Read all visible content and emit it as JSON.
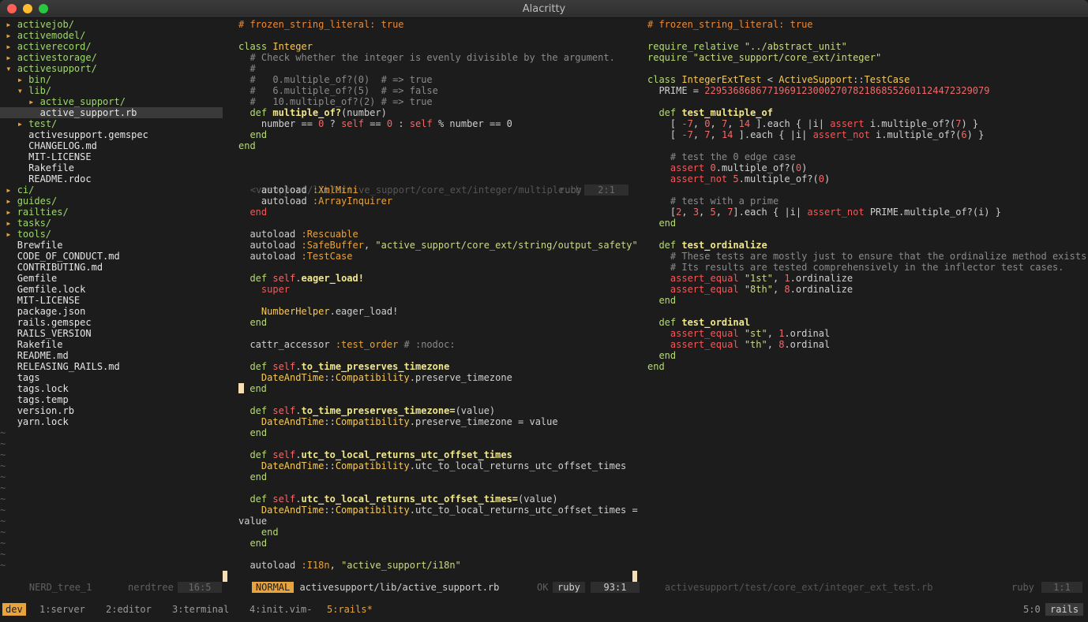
{
  "window": {
    "title": "Alacritty"
  },
  "tree": [
    {
      "icon": "▸ ",
      "name": "activejob/",
      "indent": 1,
      "kind": "dir"
    },
    {
      "icon": "▸ ",
      "name": "activemodel/",
      "indent": 1,
      "kind": "dir"
    },
    {
      "icon": "▸ ",
      "name": "activerecord/",
      "indent": 1,
      "kind": "dir"
    },
    {
      "icon": "▸ ",
      "name": "activestorage/",
      "indent": 1,
      "kind": "dir"
    },
    {
      "icon": "▾ ",
      "name": "activesupport/",
      "indent": 1,
      "kind": "dir"
    },
    {
      "icon": "▸ ",
      "name": "bin/",
      "indent": 3,
      "kind": "dir"
    },
    {
      "icon": "▾ ",
      "name": "lib/",
      "indent": 3,
      "kind": "dir"
    },
    {
      "icon": "▸ ",
      "name": "active_support/",
      "indent": 5,
      "kind": "dir"
    },
    {
      "icon": "",
      "name": "active_support.rb",
      "indent": 7,
      "kind": "file",
      "selected": true
    },
    {
      "icon": "▸ ",
      "name": "test/",
      "indent": 3,
      "kind": "dir"
    },
    {
      "icon": "",
      "name": "activesupport.gemspec",
      "indent": 5,
      "kind": "file"
    },
    {
      "icon": "",
      "name": "CHANGELOG.md",
      "indent": 5,
      "kind": "file"
    },
    {
      "icon": "",
      "name": "MIT-LICENSE",
      "indent": 5,
      "kind": "file"
    },
    {
      "icon": "",
      "name": "Rakefile",
      "indent": 5,
      "kind": "file"
    },
    {
      "icon": "",
      "name": "README.rdoc",
      "indent": 5,
      "kind": "file"
    },
    {
      "icon": "▸ ",
      "name": "ci/",
      "indent": 1,
      "kind": "dir"
    },
    {
      "icon": "▸ ",
      "name": "guides/",
      "indent": 1,
      "kind": "dir"
    },
    {
      "icon": "▸ ",
      "name": "railties/",
      "indent": 1,
      "kind": "dir"
    },
    {
      "icon": "▸ ",
      "name": "tasks/",
      "indent": 1,
      "kind": "dir"
    },
    {
      "icon": "▸ ",
      "name": "tools/",
      "indent": 1,
      "kind": "dir"
    },
    {
      "icon": "",
      "name": "Brewfile",
      "indent": 3,
      "kind": "file"
    },
    {
      "icon": "",
      "name": "CODE_OF_CONDUCT.md",
      "indent": 3,
      "kind": "file"
    },
    {
      "icon": "",
      "name": "CONTRIBUTING.md",
      "indent": 3,
      "kind": "file"
    },
    {
      "icon": "",
      "name": "Gemfile",
      "indent": 3,
      "kind": "file"
    },
    {
      "icon": "",
      "name": "Gemfile.lock",
      "indent": 3,
      "kind": "file"
    },
    {
      "icon": "",
      "name": "MIT-LICENSE",
      "indent": 3,
      "kind": "file"
    },
    {
      "icon": "",
      "name": "package.json",
      "indent": 3,
      "kind": "file"
    },
    {
      "icon": "",
      "name": "rails.gemspec",
      "indent": 3,
      "kind": "file"
    },
    {
      "icon": "",
      "name": "RAILS_VERSION",
      "indent": 3,
      "kind": "file"
    },
    {
      "icon": "",
      "name": "Rakefile",
      "indent": 3,
      "kind": "file"
    },
    {
      "icon": "",
      "name": "README.md",
      "indent": 3,
      "kind": "file"
    },
    {
      "icon": "",
      "name": "RELEASING_RAILS.md",
      "indent": 3,
      "kind": "file"
    },
    {
      "icon": "",
      "name": "tags",
      "indent": 3,
      "kind": "file"
    },
    {
      "icon": "",
      "name": "tags.lock",
      "indent": 3,
      "kind": "file"
    },
    {
      "icon": "",
      "name": "tags.temp",
      "indent": 3,
      "kind": "file"
    },
    {
      "icon": "",
      "name": "version.rb",
      "indent": 3,
      "kind": "file"
    },
    {
      "icon": "",
      "name": "yarn.lock",
      "indent": 3,
      "kind": "file"
    }
  ],
  "tree_tildes": 13,
  "middle_top": [
    [
      [
        "c-cmo",
        "# frozen_string_literal: true"
      ]
    ],
    [],
    [
      [
        "c-kw",
        "class "
      ],
      [
        "c-cls",
        "Integer"
      ]
    ],
    [
      [
        "c-cm",
        "  # Check whether the integer is evenly divisible by the argument."
      ]
    ],
    [
      [
        "c-cm",
        "  #"
      ]
    ],
    [
      [
        "c-cm",
        "  #   0.multiple_of?(0)  # => true"
      ]
    ],
    [
      [
        "c-cm",
        "  #   6.multiple_of?(5)  # => false"
      ]
    ],
    [
      [
        "c-cm",
        "  #   10.multiple_of?(2) # => true"
      ]
    ],
    [
      [
        "c-kw",
        "  def "
      ],
      [
        "c-fn",
        "multiple_of?"
      ],
      [
        "c-op",
        "(number)"
      ]
    ],
    [
      [
        "c-op",
        "    number == "
      ],
      [
        "c-num",
        "0"
      ],
      [
        "c-op",
        " ? "
      ],
      [
        "c-self",
        "self"
      ],
      [
        "c-op",
        " == "
      ],
      [
        "c-num",
        "0"
      ],
      [
        "c-op",
        " : "
      ],
      [
        "c-self",
        "self"
      ],
      [
        "c-op",
        " % number == 0"
      ]
    ],
    [
      [
        "c-kw",
        "  end"
      ]
    ],
    [
      [
        "c-kw",
        "end"
      ]
    ]
  ],
  "middle_top_tildes": 2,
  "middle_inactive_status": {
    "path": "<vesupport/lib/active_support/core_ext/integer/multiple.rb",
    "ft": "ruby",
    "pos": "2:1"
  },
  "middle_bottom": [
    [
      [
        "c-op",
        "    autoload "
      ],
      [
        "c-sym",
        ":XmlMini"
      ]
    ],
    [
      [
        "c-op",
        "    autoload "
      ],
      [
        "c-sym",
        ":ArrayInquirer"
      ]
    ],
    [
      [
        "c-sp",
        "  end"
      ]
    ],
    [],
    [
      [
        "c-op",
        "  autoload "
      ],
      [
        "c-sym",
        ":Rescuable"
      ]
    ],
    [
      [
        "c-op",
        "  autoload "
      ],
      [
        "c-sym",
        ":SafeBuffer"
      ],
      [
        "c-op",
        ", "
      ],
      [
        "c-str",
        "\"active_support/core_ext/string/output_safety\""
      ]
    ],
    [
      [
        "c-op",
        "  autoload "
      ],
      [
        "c-sym",
        ":TestCase"
      ]
    ],
    [],
    [
      [
        "c-kw",
        "  def "
      ],
      [
        "c-self",
        "self"
      ],
      [
        "c-op",
        "."
      ],
      [
        "c-fn",
        "eager_load!"
      ]
    ],
    [
      [
        "c-as",
        "    super"
      ]
    ],
    [],
    [
      [
        "c-cls",
        "    NumberHelper"
      ],
      [
        "c-op",
        ".eager_load!"
      ]
    ],
    [
      [
        "c-kw",
        "  end"
      ]
    ],
    [],
    [
      [
        "c-op",
        "  cattr_accessor "
      ],
      [
        "c-sym",
        ":test_order"
      ],
      [
        "c-cm",
        " # :nodoc:"
      ]
    ],
    [],
    [
      [
        "c-kw",
        "  def "
      ],
      [
        "c-self",
        "self"
      ],
      [
        "c-op",
        "."
      ],
      [
        "c-fn",
        "to_time_preserves_timezone"
      ]
    ],
    [
      [
        "c-cls",
        "    DateAndTime"
      ],
      [
        "c-op",
        "::"
      ],
      [
        "c-cls",
        "Compatibility"
      ],
      [
        "c-op",
        ".preserve_timezone"
      ]
    ],
    [
      [
        "cursor",
        ""
      ],
      [
        "c-kw",
        " end"
      ]
    ],
    [],
    [
      [
        "c-kw",
        "  def "
      ],
      [
        "c-self",
        "self"
      ],
      [
        "c-op",
        "."
      ],
      [
        "c-fn",
        "to_time_preserves_timezone="
      ],
      [
        "c-op",
        "(value)"
      ]
    ],
    [
      [
        "c-cls",
        "    DateAndTime"
      ],
      [
        "c-op",
        "::"
      ],
      [
        "c-cls",
        "Compatibility"
      ],
      [
        "c-op",
        ".preserve_timezone = value"
      ]
    ],
    [
      [
        "c-kw",
        "  end"
      ]
    ],
    [],
    [
      [
        "c-kw",
        "  def "
      ],
      [
        "c-self",
        "self"
      ],
      [
        "c-op",
        "."
      ],
      [
        "c-fn",
        "utc_to_local_returns_utc_offset_times"
      ]
    ],
    [
      [
        "c-cls",
        "    DateAndTime"
      ],
      [
        "c-op",
        "::"
      ],
      [
        "c-cls",
        "Compatibility"
      ],
      [
        "c-op",
        ".utc_to_local_returns_utc_offset_times"
      ]
    ],
    [
      [
        "c-kw",
        "  end"
      ]
    ],
    [],
    [
      [
        "c-kw",
        "  def "
      ],
      [
        "c-self",
        "self"
      ],
      [
        "c-op",
        "."
      ],
      [
        "c-fn",
        "utc_to_local_returns_utc_offset_times="
      ],
      [
        "c-op",
        "(value)"
      ]
    ],
    [
      [
        "c-cls",
        "    DateAndTime"
      ],
      [
        "c-op",
        "::"
      ],
      [
        "c-cls",
        "Compatibility"
      ],
      [
        "c-op",
        ".utc_to_local_returns_utc_offset_times ="
      ]
    ],
    [
      [
        "c-op",
        "value"
      ]
    ],
    [
      [
        "c-kw",
        "    end"
      ]
    ],
    [
      [
        "c-kw",
        "  end"
      ]
    ],
    [],
    [
      [
        "c-op",
        "  autoload "
      ],
      [
        "c-sym",
        ":I18n"
      ],
      [
        "c-op",
        ", "
      ],
      [
        "c-str",
        "\"active_support/i18n\""
      ]
    ]
  ],
  "right_code": [
    [
      [
        "c-cmo",
        "# frozen_string_literal: true"
      ]
    ],
    [],
    [
      [
        "c-kw",
        "require_relative "
      ],
      [
        "c-str",
        "\"../abstract_unit\""
      ]
    ],
    [
      [
        "c-kw",
        "require "
      ],
      [
        "c-str",
        "\"active_support/core_ext/integer\""
      ]
    ],
    [],
    [
      [
        "c-kw",
        "class "
      ],
      [
        "c-cls",
        "IntegerExtTest"
      ],
      [
        "c-op",
        " < "
      ],
      [
        "c-cls",
        "ActiveSupport"
      ],
      [
        "c-op",
        "::"
      ],
      [
        "c-cls",
        "TestCase"
      ]
    ],
    [
      [
        "c-op",
        "  PRIME = "
      ],
      [
        "c-num",
        "22953686867719691230002707821868552601124472329079"
      ]
    ],
    [],
    [
      [
        "c-kw",
        "  def "
      ],
      [
        "c-fn",
        "test_multiple_of"
      ]
    ],
    [
      [
        "c-op",
        "    [ "
      ],
      [
        "c-num",
        "-7"
      ],
      [
        "c-op",
        ", "
      ],
      [
        "c-num",
        "0"
      ],
      [
        "c-op",
        ", "
      ],
      [
        "c-num",
        "7"
      ],
      [
        "c-op",
        ", "
      ],
      [
        "c-num",
        "14"
      ],
      [
        "c-op",
        " ].each { |i| "
      ],
      [
        "c-as",
        "assert"
      ],
      [
        "c-op",
        " i.multiple_of?("
      ],
      [
        "c-num",
        "7"
      ],
      [
        "c-op",
        ") }"
      ]
    ],
    [
      [
        "c-op",
        "    [ "
      ],
      [
        "c-num",
        "-7"
      ],
      [
        "c-op",
        ", "
      ],
      [
        "c-num",
        "7"
      ],
      [
        "c-op",
        ", "
      ],
      [
        "c-num",
        "14"
      ],
      [
        "c-op",
        " ].each { |i| "
      ],
      [
        "c-as",
        "assert_not"
      ],
      [
        "c-op",
        " i.multiple_of?("
      ],
      [
        "c-num",
        "6"
      ],
      [
        "c-op",
        ") }"
      ]
    ],
    [],
    [
      [
        "c-cm",
        "    # test the 0 edge case"
      ]
    ],
    [
      [
        "c-as",
        "    assert "
      ],
      [
        "c-num",
        "0"
      ],
      [
        "c-op",
        ".multiple_of?("
      ],
      [
        "c-num",
        "0"
      ],
      [
        "c-op",
        ")"
      ]
    ],
    [
      [
        "c-as",
        "    assert_not "
      ],
      [
        "c-num",
        "5"
      ],
      [
        "c-op",
        ".multiple_of?("
      ],
      [
        "c-num",
        "0"
      ],
      [
        "c-op",
        ")"
      ]
    ],
    [],
    [
      [
        "c-cm",
        "    # test with a prime"
      ]
    ],
    [
      [
        "c-op",
        "    ["
      ],
      [
        "c-num",
        "2"
      ],
      [
        "c-op",
        ", "
      ],
      [
        "c-num",
        "3"
      ],
      [
        "c-op",
        ", "
      ],
      [
        "c-num",
        "5"
      ],
      [
        "c-op",
        ", "
      ],
      [
        "c-num",
        "7"
      ],
      [
        "c-op",
        "].each { |i| "
      ],
      [
        "c-as",
        "assert_not"
      ],
      [
        "c-op",
        " PRIME.multiple_of?(i) }"
      ]
    ],
    [
      [
        "c-kw",
        "  end"
      ]
    ],
    [],
    [
      [
        "c-kw",
        "  def "
      ],
      [
        "c-fn",
        "test_ordinalize"
      ]
    ],
    [
      [
        "c-cm",
        "    # These tests are mostly just to ensure that the ordinalize method exists."
      ]
    ],
    [
      [
        "c-cm",
        "    # Its results are tested comprehensively in the inflector test cases."
      ]
    ],
    [
      [
        "c-as",
        "    assert_equal "
      ],
      [
        "c-str",
        "\"1st\""
      ],
      [
        "c-op",
        ", "
      ],
      [
        "c-num",
        "1"
      ],
      [
        "c-op",
        ".ordinalize"
      ]
    ],
    [
      [
        "c-as",
        "    assert_equal "
      ],
      [
        "c-str",
        "\"8th\""
      ],
      [
        "c-op",
        ", "
      ],
      [
        "c-num",
        "8"
      ],
      [
        "c-op",
        ".ordinalize"
      ]
    ],
    [
      [
        "c-kw",
        "  end"
      ]
    ],
    [],
    [
      [
        "c-kw",
        "  def "
      ],
      [
        "c-fn",
        "test_ordinal"
      ]
    ],
    [
      [
        "c-as",
        "    assert_equal "
      ],
      [
        "c-str",
        "\"st\""
      ],
      [
        "c-op",
        ", "
      ],
      [
        "c-num",
        "1"
      ],
      [
        "c-op",
        ".ordinal"
      ]
    ],
    [
      [
        "c-as",
        "    assert_equal "
      ],
      [
        "c-str",
        "\"th\""
      ],
      [
        "c-op",
        ", "
      ],
      [
        "c-num",
        "8"
      ],
      [
        "c-op",
        ".ordinal"
      ]
    ],
    [
      [
        "c-kw",
        "  end"
      ]
    ],
    [
      [
        "c-kw",
        "end"
      ]
    ]
  ],
  "right_tildes": 17,
  "status": {
    "tree_name": "NERD_tree_1",
    "tree_ft": "nerdtree",
    "tree_pos": "16:5",
    "mode": "NORMAL",
    "mid_path": "activesupport/lib/active_support.rb",
    "mid_ok": "OK",
    "mid_ft": "ruby",
    "mid_pos": "93:1",
    "right_path": "activesupport/test/core_ext/integer_ext_test.rb",
    "right_ft": "ruby",
    "right_pos": "1:1"
  },
  "tmux": {
    "session": "dev",
    "windows": [
      {
        "label": "1:server",
        "active": false
      },
      {
        "label": "2:editor",
        "active": false
      },
      {
        "label": "3:terminal",
        "active": false
      },
      {
        "label": "4:init.vim-",
        "active": false
      },
      {
        "label": "5:rails*",
        "active": true
      }
    ],
    "position": "5:0",
    "name": "rails"
  },
  "colors": {
    "accent": "#e8a33d",
    "background": "#1c1c1c",
    "separator": "#f5deb3"
  }
}
